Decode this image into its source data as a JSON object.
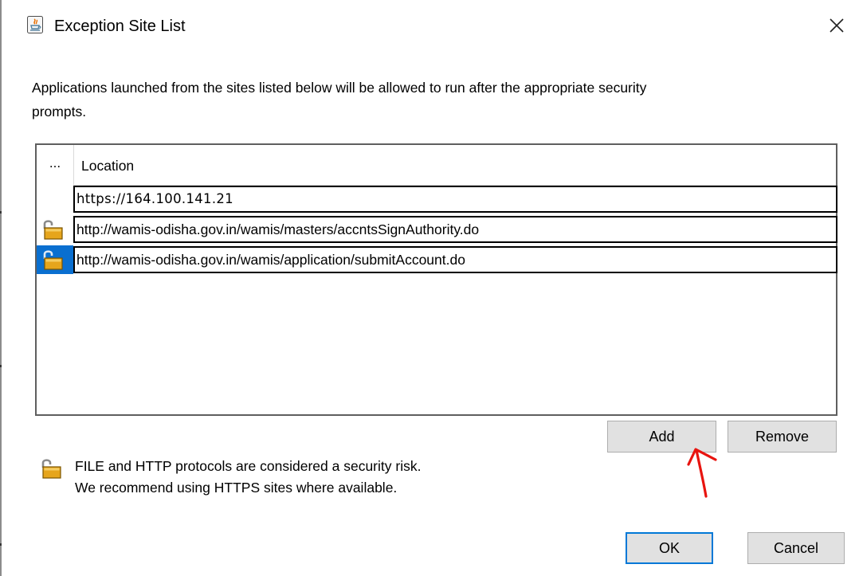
{
  "window": {
    "title": "Exception Site List",
    "close_symbol": "✕"
  },
  "description": {
    "line1": "Applications launched from the sites listed below will be allowed to run after the appropriate security",
    "line2": "prompts."
  },
  "table": {
    "columns": [
      "...",
      "Location"
    ],
    "rows": [
      {
        "icon": "none",
        "url": "https://164.100.141.21",
        "selected": false
      },
      {
        "icon": "unlocked-padlock-icon",
        "url": "http://wamis-odisha.gov.in/wamis/masters/accntsSignAuthority.do",
        "selected": false
      },
      {
        "icon": "unlocked-padlock-icon",
        "url": "http://wamis-odisha.gov.in/wamis/application/submitAccount.do",
        "selected": true
      }
    ]
  },
  "buttons": {
    "add": "Add",
    "remove": "Remove",
    "ok": "OK",
    "cancel": "Cancel"
  },
  "security_note": {
    "line1": "FILE and HTTP protocols are considered a security risk.",
    "line2": "We recommend using HTTPS sites where available."
  },
  "colors": {
    "selection": "#0a6fd0",
    "button_face": "#e1e1e1",
    "default_button_border": "#0078d7",
    "annotation_red": "#e8140f",
    "padlock_gold": "#e6a51c"
  }
}
